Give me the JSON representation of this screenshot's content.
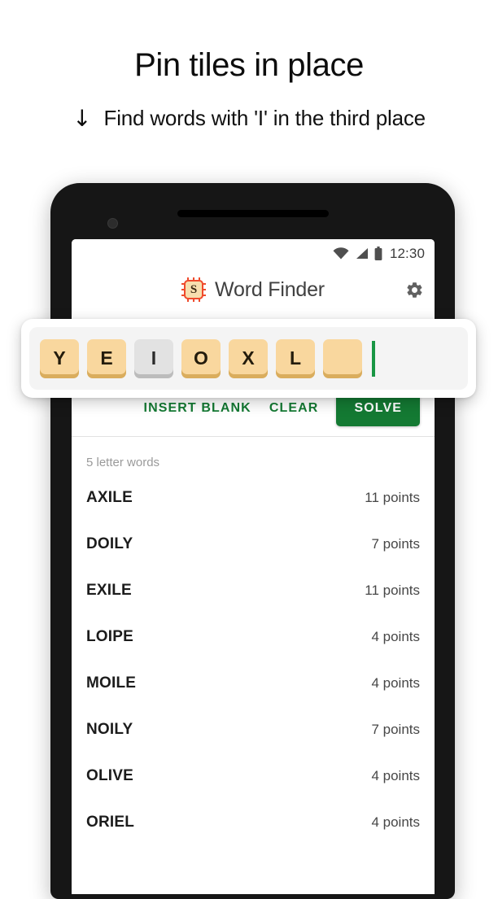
{
  "promo": {
    "title": "Pin tiles in place",
    "arrow_icon": "down-arrow-icon",
    "subtitle": "Find words with 'I' in the third place"
  },
  "phone": {
    "camera_icon": "front-camera-icon",
    "speaker_icon": "earpiece-speaker-icon"
  },
  "statusbar": {
    "wifi_icon": "wifi-icon",
    "signal_icon": "cellular-signal-icon",
    "battery_icon": "battery-icon",
    "time": "12:30"
  },
  "appbar": {
    "logo_icon": "scrabble-s-tile-logo-icon",
    "logo_letter": "S",
    "title": "Word Finder",
    "settings_icon": "gear-icon"
  },
  "tile_rack": {
    "tiles": [
      {
        "letter": "Y",
        "state": "letter"
      },
      {
        "letter": "E",
        "state": "letter"
      },
      {
        "letter": "I",
        "state": "pinned"
      },
      {
        "letter": "O",
        "state": "letter"
      },
      {
        "letter": "X",
        "state": "letter"
      },
      {
        "letter": "L",
        "state": "letter"
      },
      {
        "letter": "",
        "state": "blank"
      }
    ],
    "caret_color": "#199644"
  },
  "actions": {
    "insert_blank_label": "INSERT BLANK",
    "clear_label": "CLEAR",
    "solve_label": "SOLVE",
    "accent_color": "#147a33"
  },
  "results": {
    "group_header": "5 letter words",
    "rows": [
      {
        "word": "AXILE",
        "points": "11 points"
      },
      {
        "word": "DOILY",
        "points": "7 points"
      },
      {
        "word": "EXILE",
        "points": "11 points"
      },
      {
        "word": "LOIPE",
        "points": "4 points"
      },
      {
        "word": "MOILE",
        "points": "4 points"
      },
      {
        "word": "NOILY",
        "points": "7 points"
      },
      {
        "word": "OLIVE",
        "points": "4 points"
      },
      {
        "word": "ORIEL",
        "points": "4 points"
      }
    ]
  }
}
